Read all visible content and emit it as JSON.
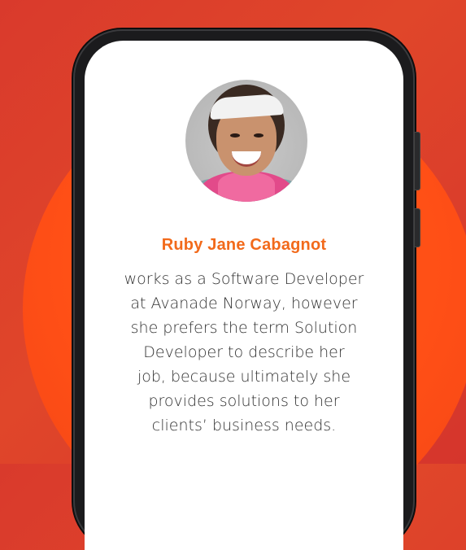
{
  "profile": {
    "name": "Ruby Jane Cabagnot",
    "bio_lines": [
      "works as a Software Developer",
      "at Avanade Norway, however",
      "she prefers the term Solution",
      "Developer to describe her",
      "job, because ultimately she",
      "provides solutions to her",
      "clients’ business needs."
    ]
  },
  "colors": {
    "background": "#dc3f2b",
    "circle": "#ff5a1a",
    "name": "#f26a1b",
    "text": "#333333"
  }
}
